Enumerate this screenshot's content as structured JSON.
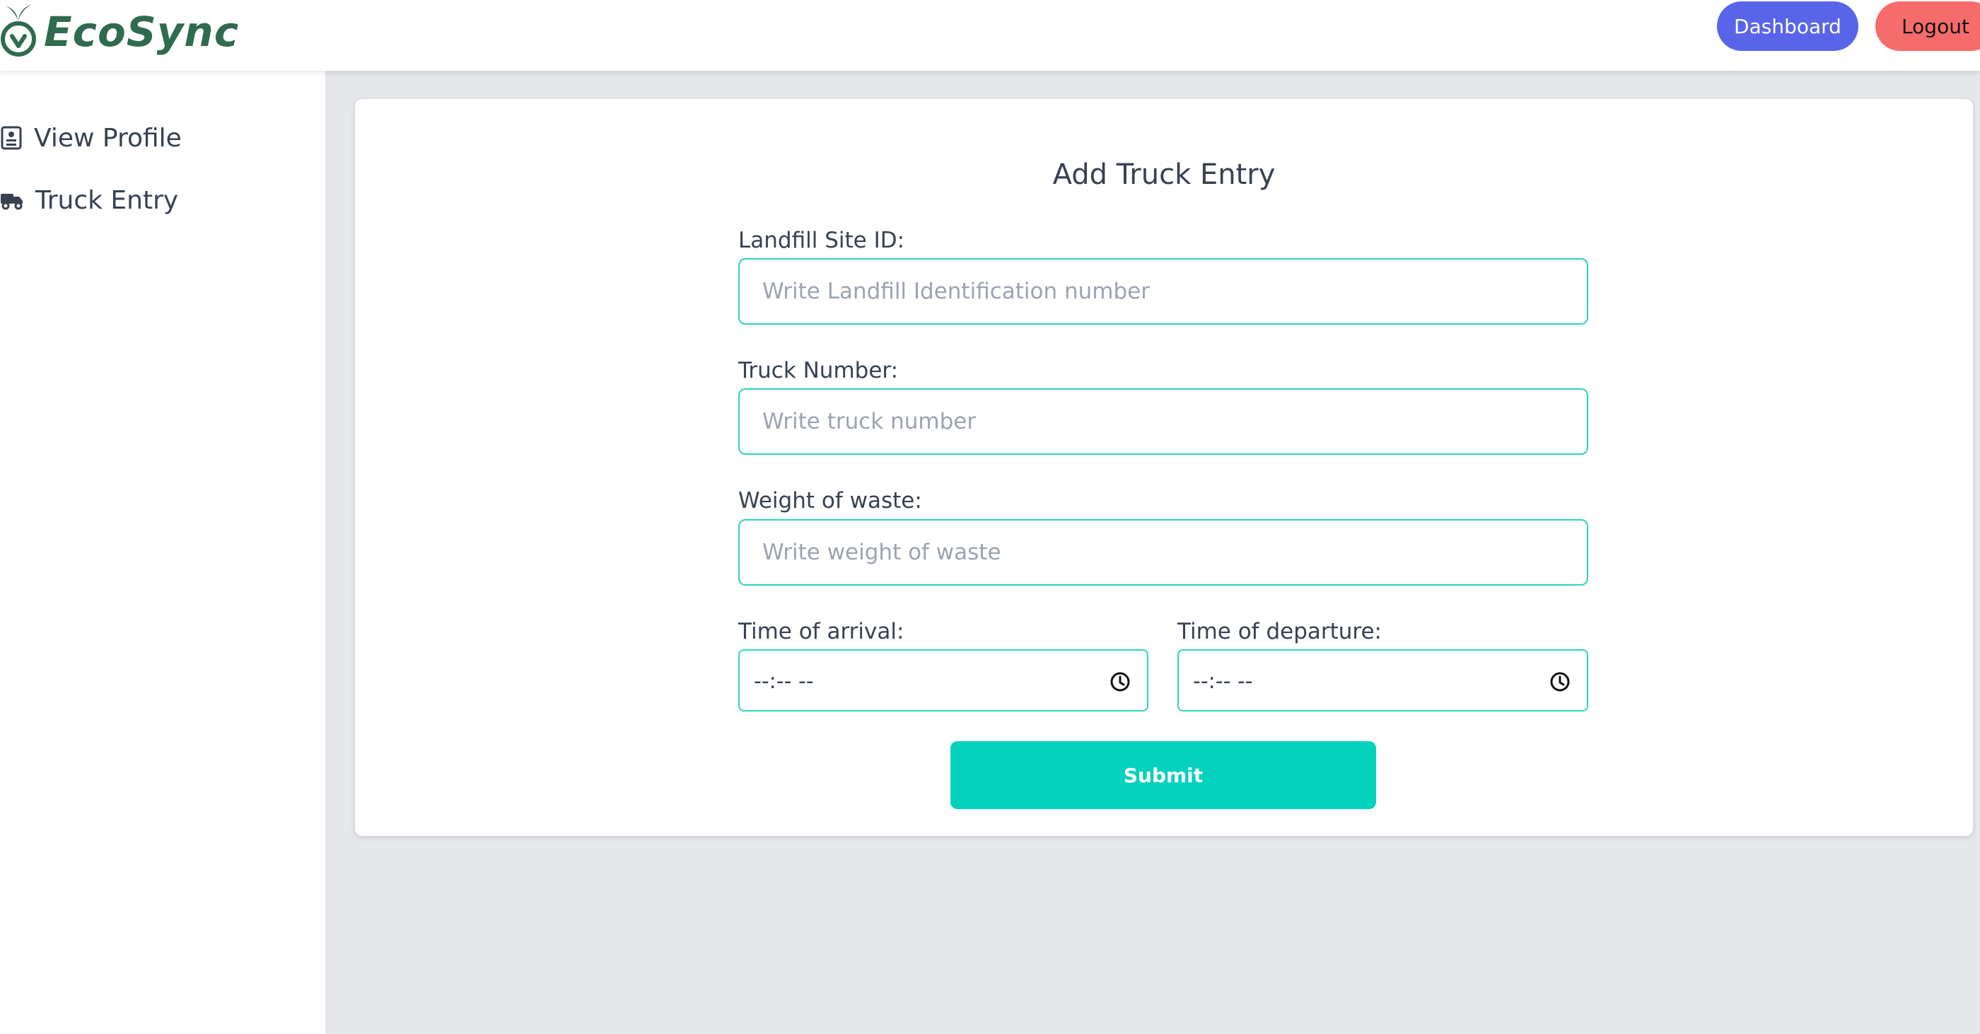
{
  "header": {
    "brand": "EcoSync",
    "brand_icon": "leaf-apple-icon",
    "buttons": {
      "dashboard": "Dashboard",
      "logout": "Logout"
    }
  },
  "sidebar": {
    "items": [
      {
        "label": "View Profile",
        "icon": "profile-card-icon"
      },
      {
        "label": "Truck Entry",
        "icon": "truck-icon"
      }
    ]
  },
  "form": {
    "title": "Add Truck Entry",
    "landfill": {
      "label": "Landfill Site ID:",
      "placeholder": "Write Landfill Identification number"
    },
    "truck": {
      "label": "Truck Number:",
      "placeholder": "Write truck number"
    },
    "weight": {
      "label": "Weight of waste:",
      "placeholder": "Write weight of waste"
    },
    "arrival": {
      "label": "Time of arrival:",
      "value": "--:-- --"
    },
    "departure": {
      "label": "Time of departure:",
      "value": "--:-- --"
    },
    "submit": "Submit"
  },
  "colors": {
    "brand_green": "#2f6b4f",
    "dashboard_button": "#5865e8",
    "logout_button": "#f76b6b",
    "input_border": "#2dd4bf",
    "submit_button": "#05d1bf",
    "page_background": "#e5e7eb"
  }
}
